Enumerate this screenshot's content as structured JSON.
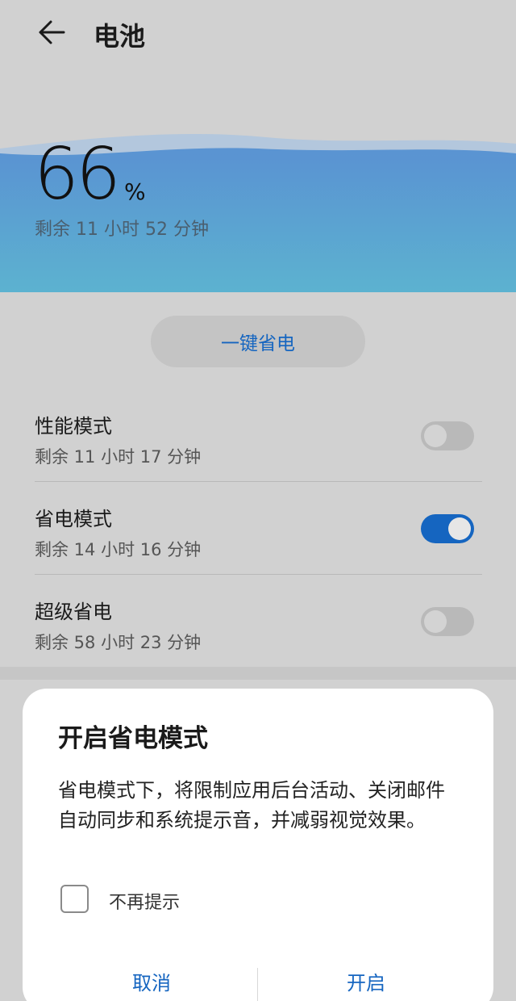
{
  "header": {
    "title": "电池",
    "back_icon": "arrow-left-icon"
  },
  "battery": {
    "percent": "66",
    "percent_sign": "%",
    "remaining": "剩余 11 小时 52 分钟",
    "level": 0.66,
    "wave_color": "#5b9bd5"
  },
  "one_key_saver": {
    "label": "一键省电"
  },
  "modes": [
    {
      "title": "性能模式",
      "remaining": "剩余 11 小时 17 分钟",
      "enabled": false
    },
    {
      "title": "省电模式",
      "remaining": "剩余 14 小时 16 分钟",
      "enabled": true
    },
    {
      "title": "超级省电",
      "remaining": "剩余 58 小时 23 分钟",
      "enabled": false
    }
  ],
  "dialog": {
    "title": "开启省电模式",
    "body": "省电模式下，将限制应用后台活动、关闭邮件自动同步和系统提示音，并减弱视觉效果。",
    "checkbox_label": "不再提示",
    "checkbox_checked": false,
    "cancel_label": "取消",
    "confirm_label": "开启"
  },
  "colors": {
    "accent": "#1565c0",
    "background": "#d1d1d1",
    "dialog_bg": "#ffffff"
  }
}
